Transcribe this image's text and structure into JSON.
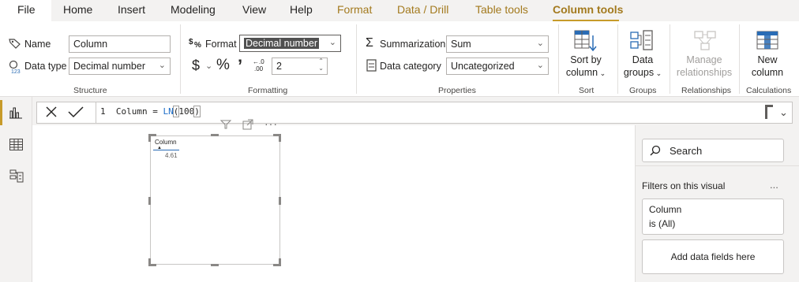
{
  "menu": {
    "file": "File",
    "home": "Home",
    "insert": "Insert",
    "modeling": "Modeling",
    "view": "View",
    "help": "Help",
    "format": "Format",
    "data_drill": "Data / Drill",
    "table_tools": "Table tools",
    "column_tools": "Column tools"
  },
  "ribbon": {
    "structure": {
      "name_label": "Name",
      "name_value": "Column",
      "datatype_label": "Data type",
      "datatype_value": "Decimal number",
      "group_label": "Structure"
    },
    "formatting": {
      "format_label": "Format",
      "format_value": "Decimal number",
      "currency_symbol": "$",
      "percent_symbol": "%",
      "comma_symbol": "’",
      "decimal_places": "2",
      "group_label": "Formatting"
    },
    "properties": {
      "summarization_label": "Summarization",
      "summarization_value": "Sum",
      "category_label": "Data category",
      "category_value": "Uncategorized",
      "group_label": "Properties"
    },
    "sort": {
      "button_line1": "Sort by",
      "button_line2": "column",
      "group_label": "Sort"
    },
    "groups": {
      "button_line1": "Data",
      "button_line2": "groups",
      "group_label": "Groups"
    },
    "relationships": {
      "button_line1": "Manage",
      "button_line2": "relationships",
      "group_label": "Relationships"
    },
    "calculations": {
      "button_line1": "New",
      "button_line2": "column",
      "group_label": "Calculations"
    }
  },
  "formula": {
    "line_number": "1",
    "expression_prefix": "Column = ",
    "function_name": "LN",
    "open_paren": "(",
    "argument": "100",
    "close_paren": ")"
  },
  "visual": {
    "card_title": "Column",
    "card_value": "4.61"
  },
  "filters_pane": {
    "search_placeholder": "Search",
    "section_title": "Filters on this visual",
    "more": "...",
    "filter_field": "Column",
    "filter_state": "is (All)",
    "add_fields": "Add data fields here"
  },
  "colors": {
    "accent": "#c79b2a",
    "context_tab": "#a37a1e",
    "function_blue": "#1e6ec8",
    "icon_blue": "#2a6cb5"
  },
  "icons": {
    "report_view": "bar-chart-icon",
    "data_view": "table-grid-icon",
    "model_view": "model-icon",
    "cancel": "close-icon",
    "commit": "checkmark-icon",
    "search": "search-icon",
    "filter": "funnel-icon",
    "focus": "expand-icon",
    "more_options": "ellipsis-icon"
  }
}
